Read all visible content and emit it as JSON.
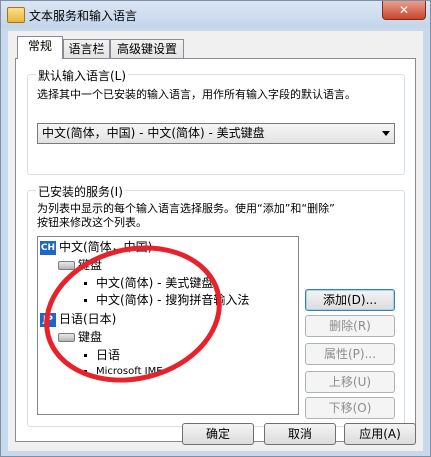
{
  "window": {
    "title": "文本服务和输入语言",
    "close_symbol": "✕",
    "icon": "window-app-icon"
  },
  "tabs": [
    {
      "label": "常规",
      "active": true
    },
    {
      "label": "语言栏",
      "active": false
    },
    {
      "label": "高级键设置",
      "active": false
    }
  ],
  "default_language": {
    "label": "默认输入语言(L)",
    "description": "选择其中一个已安装的输入语言，用作所有输入字段的默认语言。",
    "selected": "中文(简体，中国) - 中文(简体) - 美式键盘"
  },
  "installed_services": {
    "label": "已安装的服务(I)",
    "description_line1": "为列表中显示的每个输入语言选择服务。使用“添加”和“删除”",
    "description_line2": "按钮来修改这个列表。",
    "tree": {
      "lang1": {
        "badge": "CH",
        "name": "中文(简体，中国)"
      },
      "lang1_keyboard": "键盘",
      "lang1_items": [
        "中文(简体) - 美式键盘",
        "中文(简体) - 搜狗拼音输入法"
      ],
      "lang2": {
        "badge": "JP",
        "name": "日语(日本)"
      },
      "lang2_keyboard": "键盘",
      "lang2_items": [
        "日语",
        "Microsoft IME"
      ]
    }
  },
  "side_buttons": {
    "add": "添加(D)...",
    "remove": "删除(R)",
    "properties": "属性(P)...",
    "move_up": "上移(U)",
    "move_down": "下移(O)"
  },
  "bottom_buttons": {
    "ok": "确定",
    "cancel": "取消",
    "apply": "应用(A)"
  },
  "colors": {
    "annotation_circle": "#e8212a",
    "language_badge": "#1e67c7"
  }
}
